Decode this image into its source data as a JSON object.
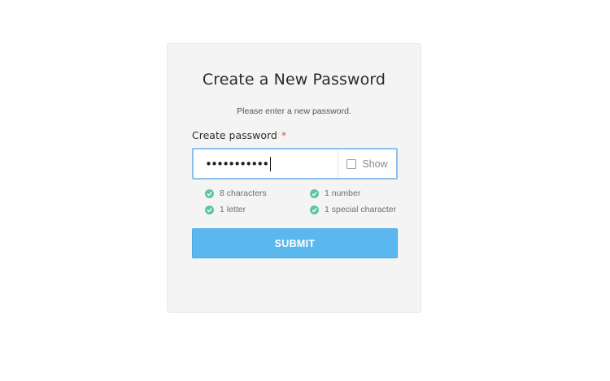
{
  "card": {
    "title": "Create a New Password",
    "subtitle": "Please enter a new password."
  },
  "field": {
    "label": "Create password",
    "required_mark": "*",
    "masked_value": "•••••••••••",
    "show_label": "Show",
    "show_checked": false
  },
  "requirements": [
    {
      "label": "8 characters",
      "met": true
    },
    {
      "label": "1 number",
      "met": true
    },
    {
      "label": "1 letter",
      "met": true
    },
    {
      "label": "1 special character",
      "met": true
    }
  ],
  "submit_label": "SUBMIT",
  "colors": {
    "accent": "#5bb8ef",
    "check": "#5dc5a6",
    "required": "#e0554c",
    "focus_border": "#8ec0ee"
  }
}
